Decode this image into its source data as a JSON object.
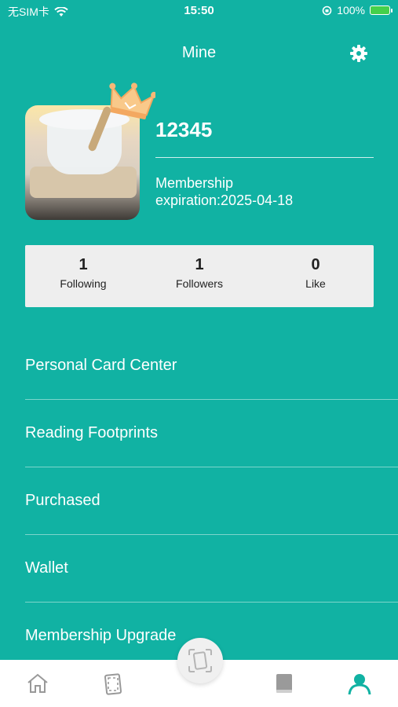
{
  "status_bar": {
    "carrier": "无SIM卡",
    "time": "15:50",
    "battery": "100%"
  },
  "header": {
    "title": "Mine"
  },
  "profile": {
    "username": "12345",
    "membership_line1": "Membership",
    "membership_line2": "expiration:2025-04-18"
  },
  "stats": [
    {
      "value": "1",
      "label": "Following"
    },
    {
      "value": "1",
      "label": "Followers"
    },
    {
      "value": "0",
      "label": "Like"
    }
  ],
  "menu": [
    "Personal Card Center",
    "Reading Footprints",
    "Purchased",
    "Wallet",
    "Membership Upgrade"
  ],
  "tabs": [
    {
      "icon": "home-icon"
    },
    {
      "icon": "cards-icon"
    },
    {
      "icon": "scan-icon"
    },
    {
      "icon": "book-icon"
    },
    {
      "icon": "profile-icon"
    }
  ],
  "colors": {
    "background": "#11b2a3",
    "stats_bg": "#eeeeee",
    "active_tab": "#11b2a3"
  }
}
